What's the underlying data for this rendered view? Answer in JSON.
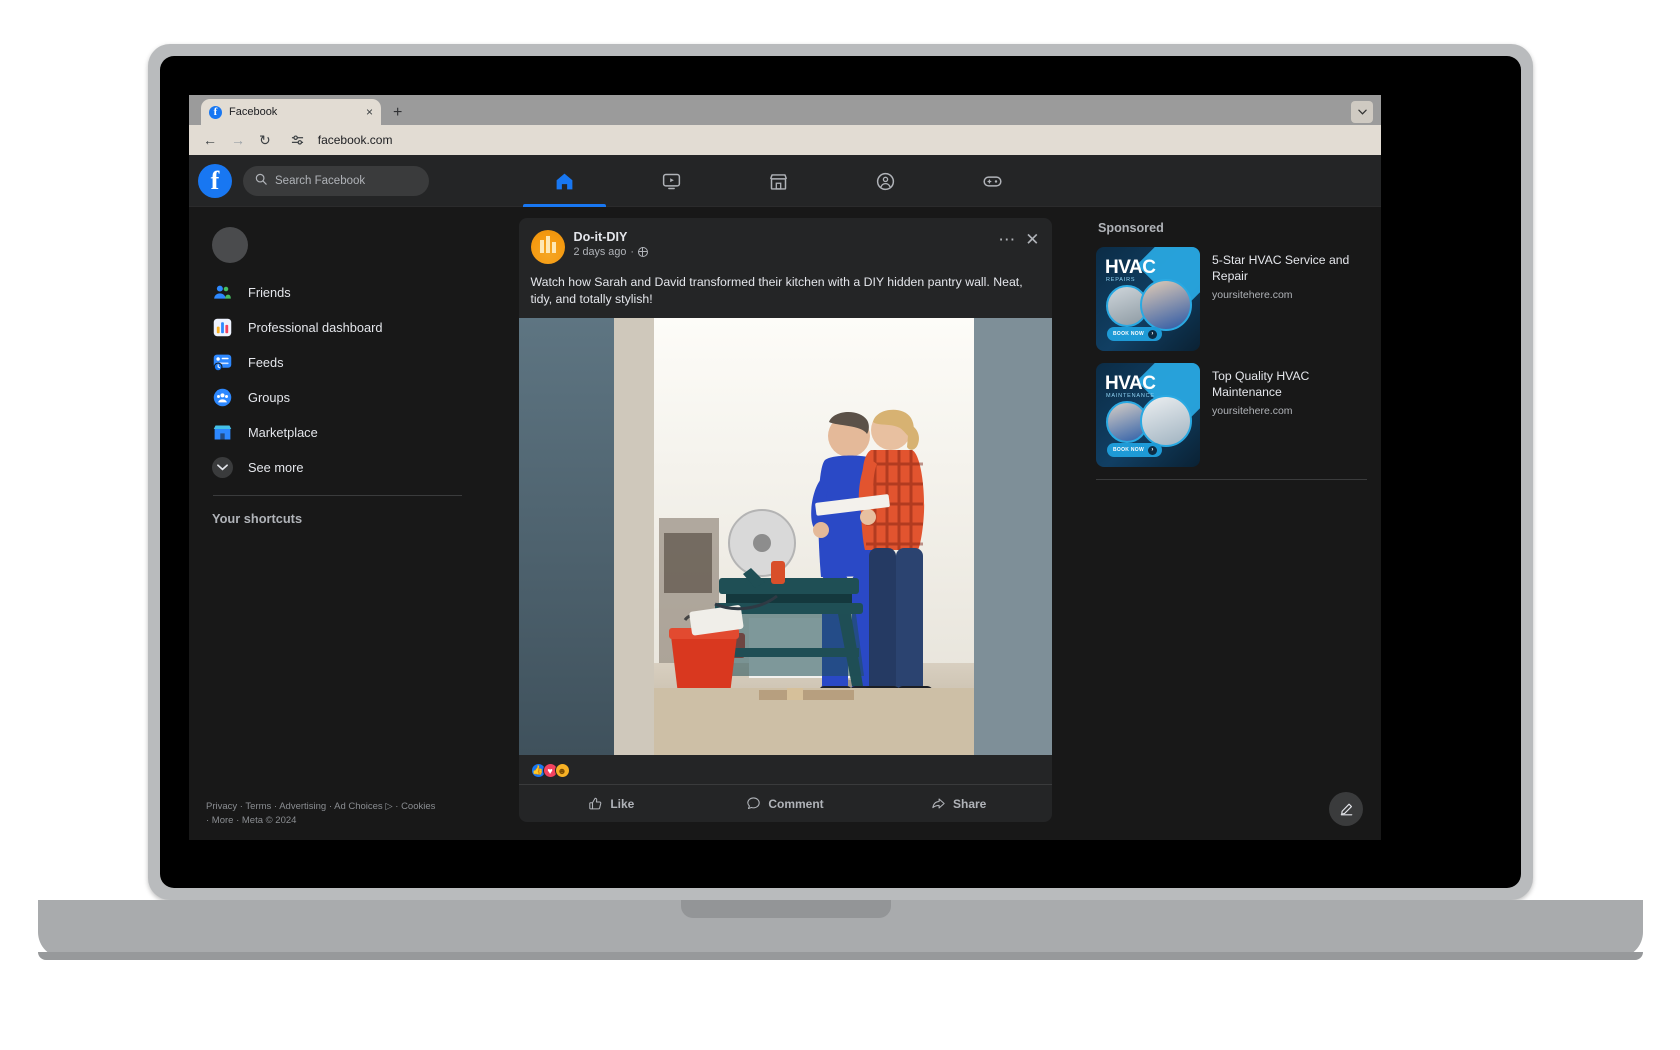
{
  "browser": {
    "tab": {
      "title": "Facebook",
      "favicon": "facebook-icon",
      "close": "×"
    },
    "new_tab": "+",
    "window_menu_icon": "chevron-down-icon",
    "back_icon": "←",
    "forward_icon": "→",
    "reload_icon": "↻",
    "site_settings_icon": "site-settings-icon",
    "url": "facebook.com"
  },
  "topbar": {
    "logo": "f",
    "search_placeholder": "Search Facebook",
    "search_icon": "search-icon",
    "nav": [
      {
        "name": "home",
        "icon": "home-icon",
        "active": true
      },
      {
        "name": "video",
        "icon": "video-icon",
        "active": false
      },
      {
        "name": "marketplace",
        "icon": "marketplace-icon",
        "active": false
      },
      {
        "name": "groups",
        "icon": "groups-icon",
        "active": false
      },
      {
        "name": "gaming",
        "icon": "gaming-icon",
        "active": false
      }
    ]
  },
  "sidebar": {
    "items": [
      {
        "label": "Friends",
        "icon": "friends-icon"
      },
      {
        "label": "Professional dashboard",
        "icon": "chart-icon"
      },
      {
        "label": "Feeds",
        "icon": "feeds-icon"
      },
      {
        "label": "Groups",
        "icon": "groups-icon"
      },
      {
        "label": "Marketplace",
        "icon": "marketplace-icon"
      },
      {
        "label": "See more",
        "icon": "chevron-down-icon"
      }
    ],
    "shortcuts_title": "Your shortcuts",
    "footer": {
      "line1": "Privacy · Terms · Advertising · Ad Choices ▷ · Cookies",
      "line2": "· More · Meta © 2024"
    }
  },
  "post": {
    "author": "Do-it-DIY",
    "timestamp": "2 days ago",
    "separator": "·",
    "audience_icon": "globe-icon",
    "menu_icon": "ellipsis-icon",
    "close_icon": "close-icon",
    "body": "Watch how Sarah and David transformed their kitchen with a DIY hidden pantry wall. Neat, tidy, and totally stylish!",
    "media_alt": "Two people using a miter saw in a kitchen renovation",
    "reactions": [
      {
        "name": "like",
        "glyph": "👍"
      },
      {
        "name": "love",
        "glyph": "♥"
      },
      {
        "name": "haha",
        "glyph": "ᴗ"
      }
    ],
    "actions": [
      {
        "label": "Like",
        "icon": "thumbs-up-icon"
      },
      {
        "label": "Comment",
        "icon": "comment-icon"
      },
      {
        "label": "Share",
        "icon": "share-icon"
      }
    ]
  },
  "sponsored": {
    "title": "Sponsored",
    "ads": [
      {
        "title": "5-Star HVAC Service and Repair",
        "url": "yoursitehere.com",
        "brand": "HVAC",
        "brand_sub": "REPAIRS",
        "cta": "BOOK NOW"
      },
      {
        "title": "Top Quality HVAC Maintenance",
        "url": "yoursitehere.com",
        "brand": "HVAC",
        "brand_sub": "MAINTENANCE",
        "cta": "BOOK NOW"
      }
    ]
  },
  "fab": {
    "icon": "compose-icon"
  },
  "colors": {
    "accent": "#1877f2",
    "surface": "#242526",
    "background": "#181818",
    "text_primary": "#e4e6eb",
    "text_secondary": "#b0b3b8"
  }
}
